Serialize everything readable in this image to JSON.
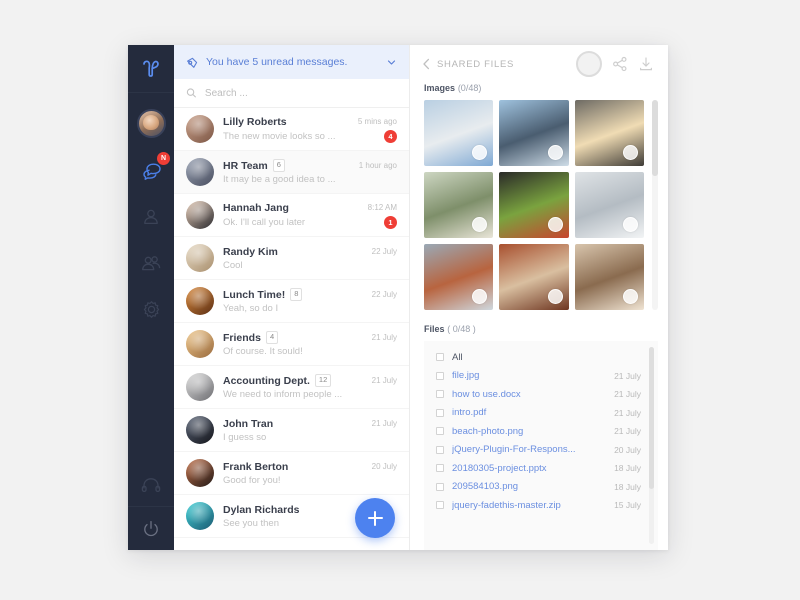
{
  "sidebar": {
    "logo_name": "app-logo",
    "user_avatar_name": "user-avatar",
    "items": [
      {
        "name": "chat",
        "icon": "chat-bubbles-icon",
        "badge": "N",
        "active": true
      },
      {
        "name": "contacts",
        "icon": "person-icon",
        "badge": "",
        "active": false
      },
      {
        "name": "groups",
        "icon": "people-group-icon",
        "badge": "",
        "active": false
      },
      {
        "name": "settings",
        "icon": "gear-icon",
        "badge": "",
        "active": false
      }
    ],
    "bottom_items": [
      {
        "name": "support",
        "icon": "headset-icon"
      },
      {
        "name": "logout",
        "icon": "power-icon"
      }
    ]
  },
  "chat_panel": {
    "banner": {
      "text": "You have 5 unread messages.",
      "icon": "megaphone-icon",
      "chevron": "chevron-down-icon"
    },
    "search": {
      "placeholder": "Search ...",
      "icon": "search-icon",
      "value": ""
    },
    "add_button_label": "+",
    "conversations": [
      {
        "name": "Lilly Roberts",
        "members": "",
        "time": "5 mins ago",
        "message": "The new movie looks so  ...",
        "unread": "4",
        "avatar_colors": [
          "#c9a18a",
          "#7d5746"
        ]
      },
      {
        "name": "HR Team",
        "members": "6",
        "time": "1 hour ago",
        "message": "It may be a good idea to ...",
        "unread": "",
        "avatar_colors": [
          "#9aa3b4",
          "#4a4f60"
        ]
      },
      {
        "name": "Hannah Jang",
        "members": "",
        "time": "8:12 AM",
        "message": "Ok. I'll call you later",
        "unread": "1",
        "avatar_colors": [
          "#e3c9b4",
          "#2b2b30"
        ]
      },
      {
        "name": "Randy Kim",
        "members": "",
        "time": "22 July",
        "message": "Cool",
        "unread": "",
        "avatar_colors": [
          "#e8dcc7",
          "#a98f6e"
        ]
      },
      {
        "name": "Lunch Time!",
        "members": "8",
        "time": "22 July",
        "message": "Yeah, so do I",
        "unread": "",
        "avatar_colors": [
          "#d98a3d",
          "#5c2f15"
        ]
      },
      {
        "name": "Friends",
        "members": "4",
        "time": "21 July",
        "message": "Of course. It sould!",
        "unread": "",
        "avatar_colors": [
          "#f0c98e",
          "#9a6b3e"
        ]
      },
      {
        "name": "Accounting Dept.",
        "members": "12",
        "time": "21 July",
        "message": "We need to inform people ...",
        "unread": "",
        "avatar_colors": [
          "#dcdcdc",
          "#6e6e72"
        ]
      },
      {
        "name": "John Tran",
        "members": "",
        "time": "21 July",
        "message": "I guess so",
        "unread": "",
        "avatar_colors": [
          "#5a6476",
          "#15161c"
        ]
      },
      {
        "name": "Frank Berton",
        "members": "",
        "time": "20 July",
        "message": "Good for you!",
        "unread": "",
        "avatar_colors": [
          "#c2714a",
          "#221a18"
        ]
      },
      {
        "name": "Dylan Richards",
        "members": "",
        "time": "",
        "message": "See you then",
        "unread": "",
        "avatar_colors": [
          "#3fd0d6",
          "#1d5a72"
        ]
      }
    ]
  },
  "files_panel": {
    "back_label": "SHARED FILES",
    "back_icon": "chevron-left-icon",
    "avatar_icon": "contact-circle-icon",
    "share_icon": "share-icon",
    "download_icon": "download-icon",
    "images_section": {
      "label": "Images",
      "count": "(0/48)"
    },
    "files_section": {
      "label": "Files",
      "count": "( 0/48 )"
    },
    "thumbnails": [
      {
        "name": "sailboat-photo",
        "c1": "#b9cfe2",
        "c2": "#e8ecef",
        "c3": "#7fa9d4"
      },
      {
        "name": "mountain-lake-photo",
        "c1": "#9fc2de",
        "c2": "#4a5d70",
        "c3": "#cfdde8"
      },
      {
        "name": "window-curtain-photo",
        "c1": "#6d6a63",
        "c2": "#f0dcb4",
        "c3": "#3e3b36"
      },
      {
        "name": "beach-aerial-photo",
        "c1": "#cdd6c2",
        "c2": "#7e8f6a",
        "c3": "#e9e5d8"
      },
      {
        "name": "food-bowl-photo",
        "c1": "#2a2a28",
        "c2": "#7aa33f",
        "c3": "#c8452e"
      },
      {
        "name": "airplane-window-photo",
        "c1": "#dfe3e6",
        "c2": "#b4bcc3",
        "c3": "#f2f4f5"
      },
      {
        "name": "golden-gate-bridge-photo",
        "c1": "#9aa9b6",
        "c2": "#b8643f",
        "c3": "#cfd8de"
      },
      {
        "name": "museum-interior-photo",
        "c1": "#a8502f",
        "c2": "#d9bfa0",
        "c3": "#6e3520"
      },
      {
        "name": "statue-photo",
        "c1": "#d8c5ad",
        "c2": "#8a6b4f",
        "c3": "#f0e4d3"
      }
    ],
    "files": [
      {
        "label": "All",
        "date": "",
        "plain": true
      },
      {
        "label": "file.jpg",
        "date": "21 July",
        "plain": false
      },
      {
        "label": "how to use.docx",
        "date": "21 July",
        "plain": false
      },
      {
        "label": "intro.pdf",
        "date": "21 July",
        "plain": false
      },
      {
        "label": "beach-photo.png",
        "date": "21 July",
        "plain": false
      },
      {
        "label": "jQuery-Plugin-For-Respons...",
        "date": "20 July",
        "plain": false
      },
      {
        "label": "20180305-project.pptx",
        "date": "18 July",
        "plain": false
      },
      {
        "label": "209584103.png",
        "date": "18 July",
        "plain": false
      },
      {
        "label": "jquery-fadethis-master.zip",
        "date": "15 July",
        "plain": false
      }
    ]
  },
  "colors": {
    "accent": "#4d82ef",
    "banner_bg": "#eaf0fc",
    "banner_text": "#5a7fd6",
    "badge_red": "#ef3e36",
    "rail_bg": "#242b3d",
    "link_blue": "#6b8fe0"
  }
}
